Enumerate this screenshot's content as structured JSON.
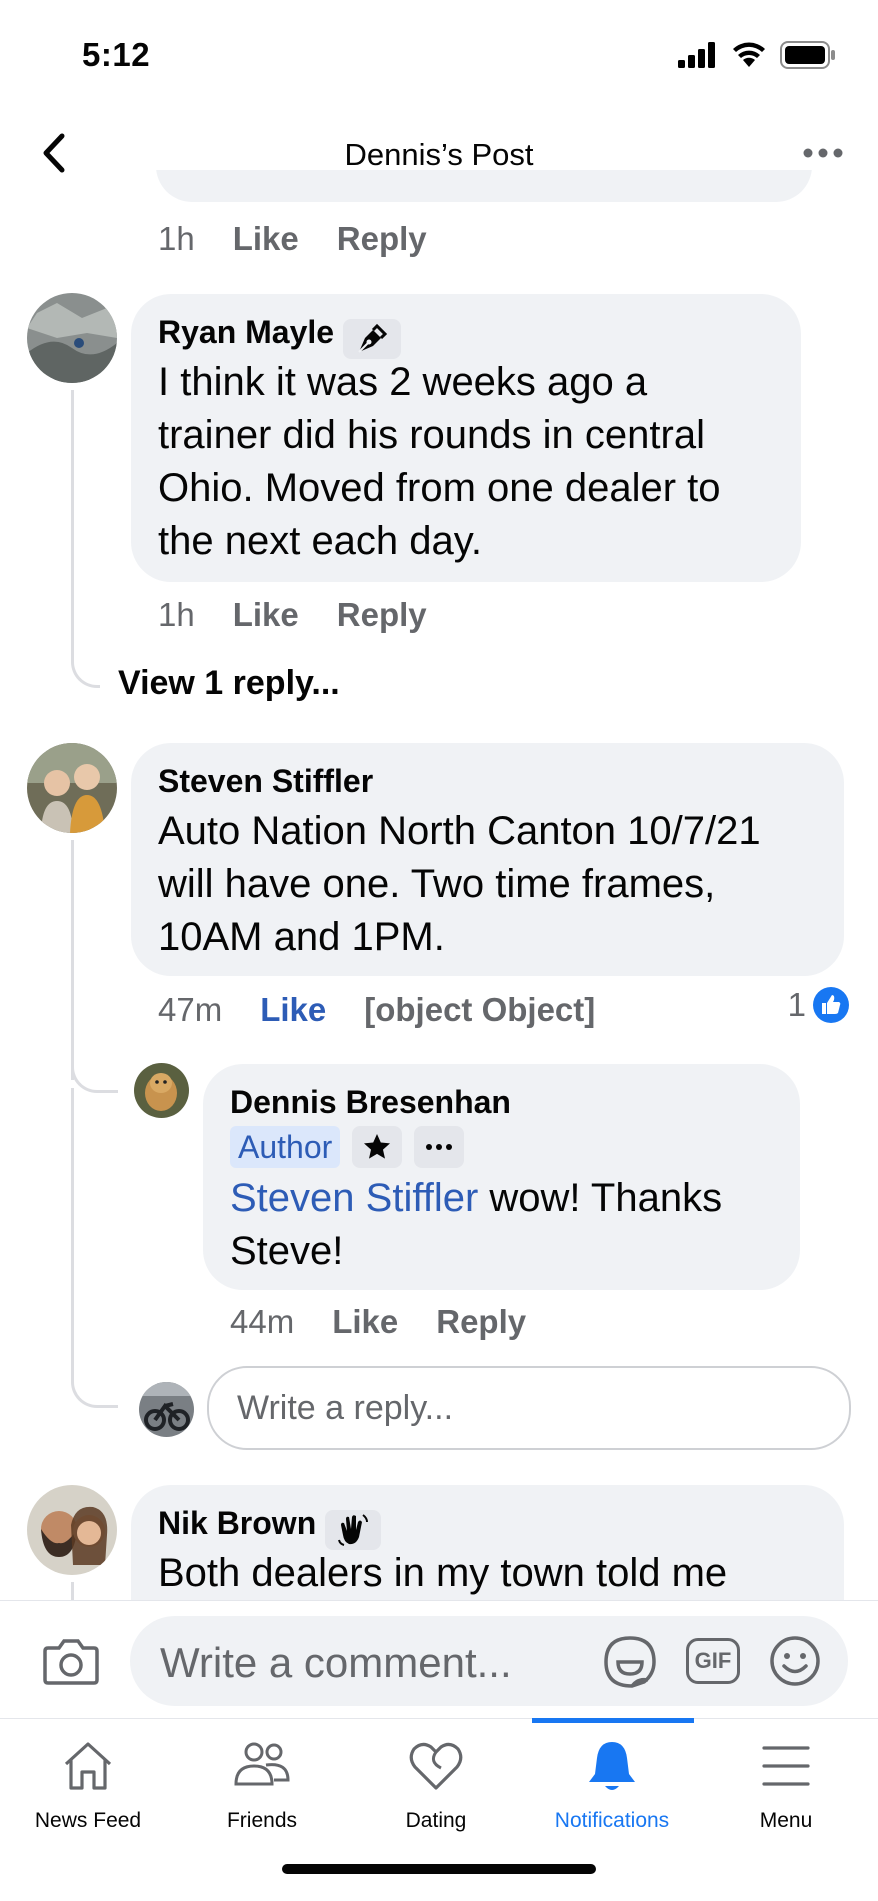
{
  "status_bar": {
    "time": "5:12"
  },
  "header": {
    "title": "Dennis’s Post"
  },
  "top_meta": {
    "time": "1h",
    "like": "Like",
    "reply": "Reply"
  },
  "comments": [
    {
      "author": "Ryan Mayle",
      "badge_icon": "pen-nib-icon",
      "lines": [
        "I think it was 2 weeks ago a",
        "trainer did his rounds in central",
        "Ohio. Moved from one dealer to",
        "the next each day."
      ],
      "time": "1h",
      "like": "Like",
      "reply": "Reply",
      "view_replies": "View 1 reply..."
    },
    {
      "author": "Steven Stiffler",
      "lines": [
        "Auto Nation North Canton 10/7/21",
        "will have one. Two time frames,",
        "10AM and 1PM."
      ],
      "time": "47m",
      "like": "Like",
      "reply": {
        "author": "Dennis Bresenhan",
        "author_badge": "Author",
        "mention": "Steven Stiffler",
        "text_after_mention": " wow! Thanks",
        "text_line2": "Steve!",
        "time": "44m",
        "like": "Like",
        "reply": "Reply"
      },
      "reaction_count": "1",
      "reply_placeholder": "Write a reply..."
    },
    {
      "author": "Nik Brown",
      "badge_icon": "waving-hand-icon",
      "lines": [
        "Both dealers in my town told me"
      ]
    }
  ],
  "composer": {
    "placeholder": "Write a comment...",
    "gif_label": "GIF"
  },
  "tabs": [
    {
      "label": "News Feed",
      "icon": "home-icon"
    },
    {
      "label": "Friends",
      "icon": "friends-icon"
    },
    {
      "label": "Dating",
      "icon": "heart-icon"
    },
    {
      "label": "Notifications",
      "icon": "bell-icon",
      "active": true
    },
    {
      "label": "Menu",
      "icon": "menu-icon"
    }
  ],
  "colors": {
    "accent": "#1877f2",
    "like_active": "#2d5cb6",
    "bubble": "#f0f2f5",
    "meta": "#65676b"
  }
}
